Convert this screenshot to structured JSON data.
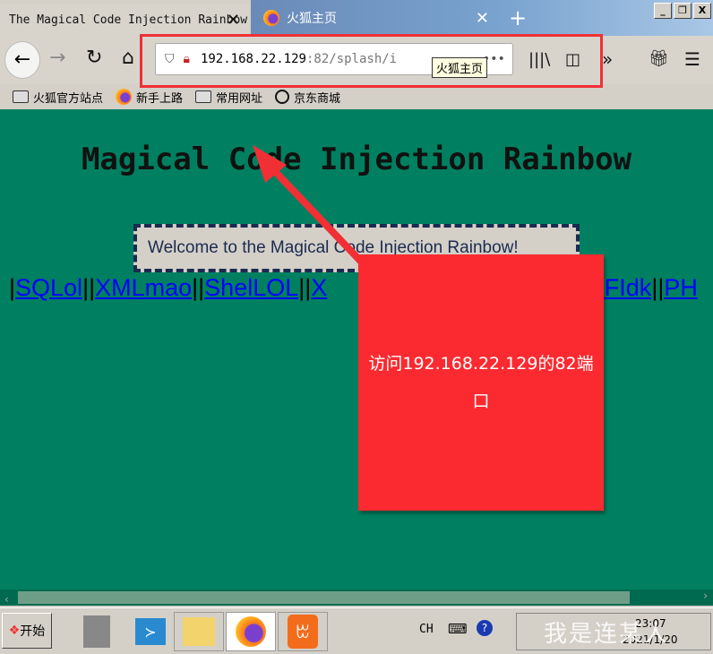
{
  "tabs": [
    {
      "label": "The Magical Code Injection Rainbow",
      "active": true
    },
    {
      "label": "火狐主页",
      "active": false
    }
  ],
  "window_buttons": {
    "minimize": "_",
    "restore": "❐",
    "close": "X"
  },
  "url": {
    "host": "192.168.22.129",
    "rest": ":82/splash/i"
  },
  "tooltip": "火狐主页",
  "bookmarks": [
    {
      "label": "火狐官方站点",
      "icon": "folder-icon"
    },
    {
      "label": "新手上路",
      "icon": "firefox-icon"
    },
    {
      "label": "常用网址",
      "icon": "folder-icon"
    },
    {
      "label": "京东商城",
      "icon": "globe-icon"
    }
  ],
  "page": {
    "heading": "Magical Code Injection Rainbow",
    "welcome": "Welcome to the Magical Code Injection Rainbow!",
    "links": [
      "SQLol",
      "XMLmao",
      "ShelLOL",
      "X",
      "RFIdk",
      "PH"
    ]
  },
  "callout": {
    "text": "访问192.168.22.129的82端口",
    "color": "#fb2a30"
  },
  "taskbar": {
    "start": "开始",
    "lang": "CH",
    "time": "23:07",
    "date": "2021/1/20",
    "watermark": "我是连某人"
  },
  "colors": {
    "page_bg": "#008060",
    "link": "#0000ff",
    "highlight": "#f03035"
  }
}
